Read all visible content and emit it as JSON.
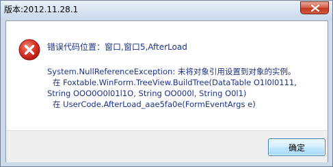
{
  "window": {
    "title": "版本:2012.11.28.1"
  },
  "dialog": {
    "icon": "error-icon",
    "heading": "错误代码位置：窗口,窗口5,AfterLoad",
    "message_lines": [
      "System.NullReferenceException: 未将对象引用设置到对象的实例。",
      "在 Foxtable.WinForm.TreeView.BuildTree(DataTable O1l0l0111,",
      "String OOO0O0l01l1O, String OO000l, String O0l1)",
      "在 UserCode.AfterLoad_aae5fa0e(FormEventArgs e)"
    ]
  },
  "buttons": {
    "ok_label": "确定"
  },
  "colors": {
    "message_text": "#1e3287",
    "error_icon": "#c8261c",
    "close_button": "#c0391f"
  }
}
